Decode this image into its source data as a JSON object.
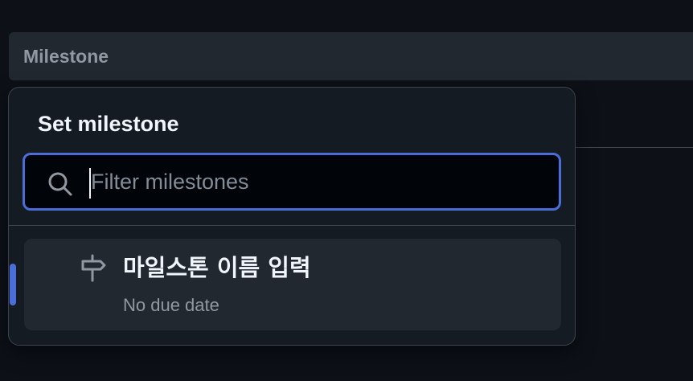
{
  "header": {
    "label": "Milestone"
  },
  "milestone_menu": {
    "title": "Set milestone",
    "filter": {
      "placeholder": "Filter milestones",
      "value": "",
      "icon": "search-icon"
    },
    "items": [
      {
        "title": "마일스톤 이름 입력",
        "description": "No due date",
        "icon": "milestone-icon",
        "active": true
      }
    ]
  },
  "colors": {
    "background": "#0d1117",
    "overlay": "#151b23",
    "item_hover": "#212830",
    "accent": "#4a6dd8",
    "text_primary": "#f0f6fc",
    "text_muted": "#9198a1"
  }
}
